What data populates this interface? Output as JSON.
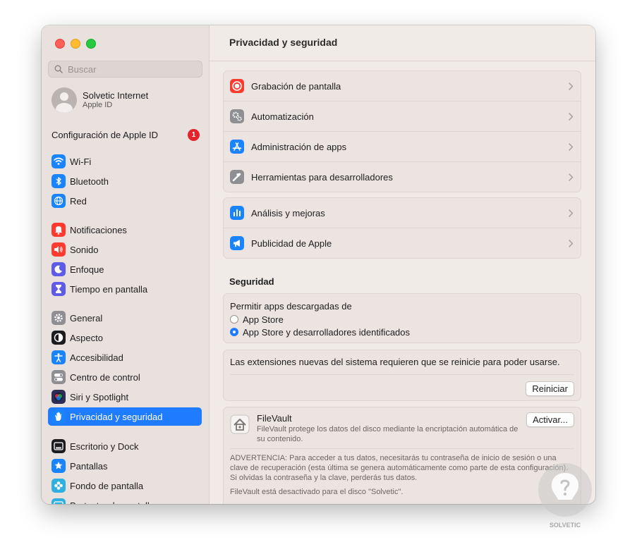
{
  "window": {
    "title": "Privacidad y seguridad"
  },
  "sidebar": {
    "search_placeholder": "Buscar",
    "profile": {
      "name": "Solvetic Internet",
      "sub": "Apple ID"
    },
    "apple_id_config": {
      "label": "Configuración de Apple ID",
      "badge": "1"
    },
    "items": [
      {
        "label": "Wi-Fi",
        "icon": "wifi-icon",
        "color": "#1a84ff"
      },
      {
        "label": "Bluetooth",
        "icon": "bluetooth-icon",
        "color": "#1a84ff"
      },
      {
        "label": "Red",
        "icon": "globe-icon",
        "color": "#1a84ff"
      },
      {
        "label": "Notificaciones",
        "icon": "bell-icon",
        "color": "#ff3b30"
      },
      {
        "label": "Sonido",
        "icon": "speaker-icon",
        "color": "#ff3b30"
      },
      {
        "label": "Enfoque",
        "icon": "moon-icon",
        "color": "#5e5ce6"
      },
      {
        "label": "Tiempo en pantalla",
        "icon": "hourglass-icon",
        "color": "#5e5ce6"
      },
      {
        "label": "General",
        "icon": "gear-icon",
        "color": "#8e8e93"
      },
      {
        "label": "Aspecto",
        "icon": "appearance-icon",
        "color": "#1c1c1e"
      },
      {
        "label": "Accesibilidad",
        "icon": "accessibility-icon",
        "color": "#1a84ff"
      },
      {
        "label": "Centro de control",
        "icon": "toggles-icon",
        "color": "#8e8e93"
      },
      {
        "label": "Siri y Spotlight",
        "icon": "siri-icon",
        "color": "#2c2c54"
      },
      {
        "label": "Privacidad y seguridad",
        "icon": "hand-icon",
        "color": "#1a84ff",
        "selected": true
      },
      {
        "label": "Escritorio y Dock",
        "icon": "dock-icon",
        "color": "#1c1c1e"
      },
      {
        "label": "Pantallas",
        "icon": "display-icon",
        "color": "#1a84ff"
      },
      {
        "label": "Fondo de pantalla",
        "icon": "flower-icon",
        "color": "#30b0e0"
      },
      {
        "label": "Protector de pantalla",
        "icon": "screensaver-icon",
        "color": "#30b0e0"
      }
    ]
  },
  "privacy_group_1": [
    {
      "label": "Grabación de pantalla",
      "icon": "record-icon",
      "color": "#ff3b30"
    },
    {
      "label": "Automatización",
      "icon": "gears-icon",
      "color": "#8e8e93"
    },
    {
      "label": "Administración de apps",
      "icon": "app-store-icon",
      "color": "#1a84ff"
    },
    {
      "label": "Herramientas para desarrolladores",
      "icon": "hammer-icon",
      "color": "#8e8e93"
    }
  ],
  "privacy_group_2": [
    {
      "label": "Análisis y mejoras",
      "icon": "chart-icon",
      "color": "#1a84ff"
    },
    {
      "label": "Publicidad de Apple",
      "icon": "megaphone-icon",
      "color": "#1a84ff"
    }
  ],
  "security": {
    "heading": "Seguridad",
    "allow_apps_label": "Permitir apps descargadas de",
    "options": [
      {
        "label": "App Store",
        "selected": false
      },
      {
        "label": "App Store y desarrolladores identificados",
        "selected": true
      }
    ],
    "extensions_text": "Las extensiones nuevas del sistema requieren que se reinicie para poder usarse.",
    "restart_button": "Reiniciar",
    "filevault": {
      "title": "FileVault",
      "description": "FileVault protege los datos del disco mediante la encriptación automática de su contenido.",
      "button": "Activar...",
      "warning": "ADVERTENCIA: Para acceder a tus datos, necesitarás tu contraseña de inicio de sesión o una clave de recuperación (esta última se genera automáticamente como parte de esta configuración). Si olvidas la contraseña y la clave, perderás tus datos.",
      "status": "FileVault está desactivado para el disco \"Solvetic\"."
    }
  },
  "watermark": {
    "label": "SOLVETIC"
  }
}
